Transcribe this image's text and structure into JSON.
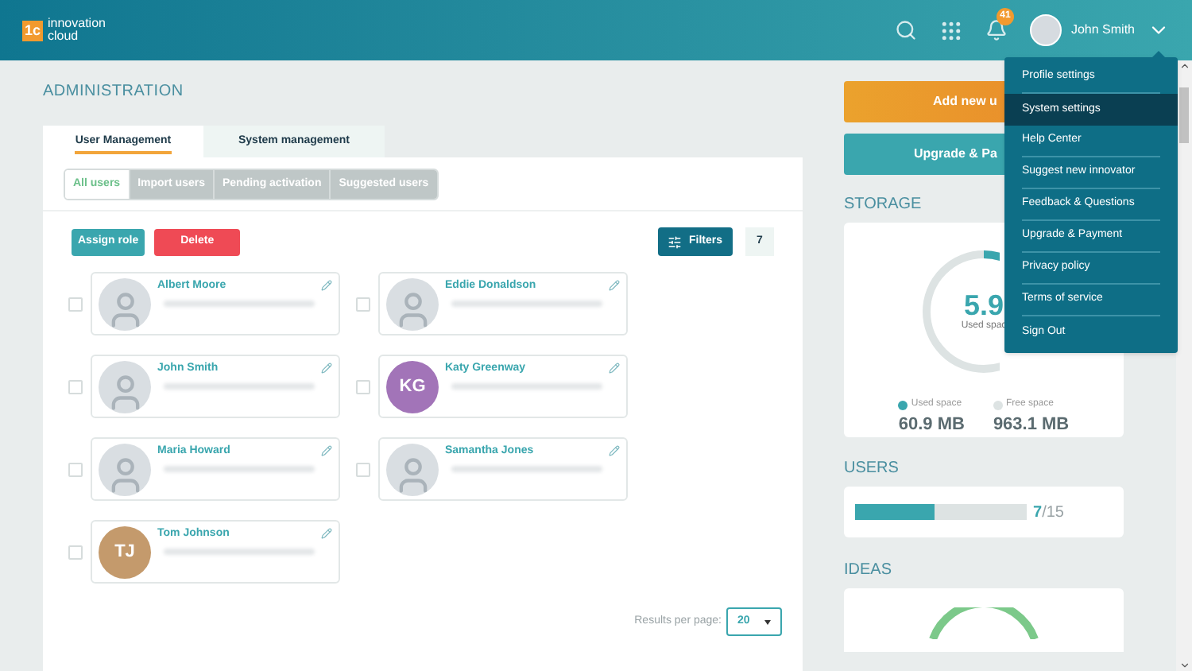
{
  "header": {
    "logo_mark": "1c",
    "logo_text_1": "innovation",
    "logo_text_2": "cloud",
    "notifications": "41",
    "user_name": "John Smith"
  },
  "page_title": "ADMINISTRATION",
  "tabs": [
    {
      "label": "User Management",
      "selected": true
    },
    {
      "label": "System management",
      "selected": false
    }
  ],
  "subtabs": [
    {
      "label": "All users",
      "selected": true
    },
    {
      "label": "Import users",
      "selected": false
    },
    {
      "label": "Pending activation",
      "selected": false
    },
    {
      "label": "Suggested users",
      "selected": false
    }
  ],
  "toolbar": {
    "assign": "Assign role",
    "delete": "Delete",
    "filters": "Filters",
    "count": "7"
  },
  "users": [
    {
      "name": "Albert Moore",
      "kind": "photo",
      "checked": false
    },
    {
      "name": "Eddie Donaldson",
      "kind": "photo",
      "checked": false
    },
    {
      "name": "John Smith",
      "kind": "photo",
      "checked": false
    },
    {
      "name": "Katy Greenway",
      "kind": "initials",
      "initials": "KG",
      "color": "#a274b8",
      "checked": false
    },
    {
      "name": "Maria Howard",
      "kind": "photo",
      "checked": false
    },
    {
      "name": "Samantha Jones",
      "kind": "photo",
      "checked": false
    },
    {
      "name": "Tom Johnson",
      "kind": "initials",
      "initials": "TJ",
      "color": "#c49a6c",
      "checked": false
    }
  ],
  "pagination": {
    "label": "Results per page:",
    "value": "20"
  },
  "sidebar": {
    "add_button": "Add new u",
    "upgrade_button": "Upgrade & Pa",
    "storage": {
      "title": "STORAGE",
      "percent": "5.9",
      "caption": "Used spac",
      "level": 0.059,
      "used_label": "Used space",
      "used_value": "60.9 MB",
      "free_label": "Free space",
      "free_value": "963.1 MB"
    },
    "users": {
      "title": "USERS",
      "level": 0.467,
      "count": "7",
      "total": "/15"
    },
    "ideas": {
      "title": "IDEAS"
    }
  },
  "menu": [
    {
      "label": "Profile settings",
      "selected": false
    },
    {
      "label": "System settings",
      "selected": true
    },
    {
      "label": "Help Center",
      "selected": false
    },
    {
      "label": "Suggest new innovator",
      "selected": false
    },
    {
      "label": "Feedback & Questions",
      "selected": false
    },
    {
      "label": "Upgrade & Payment",
      "selected": false
    },
    {
      "label": "Privacy policy",
      "selected": false
    },
    {
      "label": "Terms of service",
      "selected": false
    },
    {
      "label": "Sign Out",
      "selected": false
    }
  ]
}
